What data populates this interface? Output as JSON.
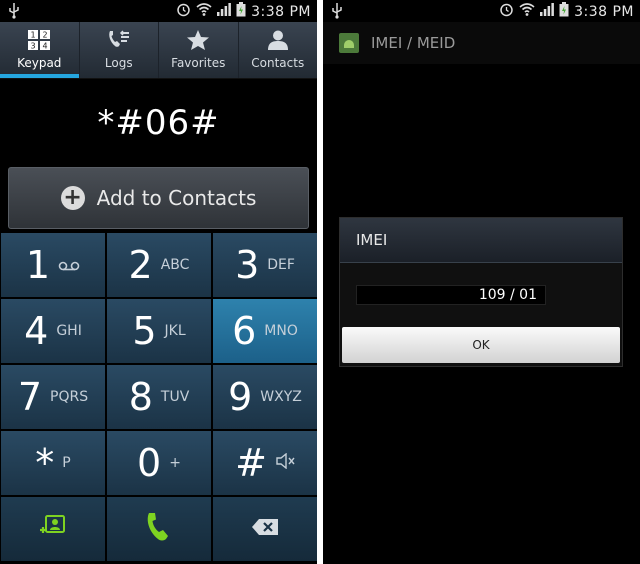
{
  "status": {
    "time": "3:38 PM"
  },
  "dialer": {
    "tabs": [
      {
        "label": "Keypad",
        "icon": "keypad-icon"
      },
      {
        "label": "Logs",
        "icon": "logs-icon"
      },
      {
        "label": "Favorites",
        "icon": "star-icon"
      },
      {
        "label": "Contacts",
        "icon": "contacts-icon"
      }
    ],
    "active_tab": "Keypad",
    "dialed_number": "*#06#",
    "add_to_contacts_label": "Add to Contacts",
    "keys": [
      {
        "digit": "1",
        "letters": ""
      },
      {
        "digit": "2",
        "letters": "ABC"
      },
      {
        "digit": "3",
        "letters": "DEF"
      },
      {
        "digit": "4",
        "letters": "GHI"
      },
      {
        "digit": "5",
        "letters": "JKL"
      },
      {
        "digit": "6",
        "letters": "MNO"
      },
      {
        "digit": "7",
        "letters": "PQRS"
      },
      {
        "digit": "8",
        "letters": "TUV"
      },
      {
        "digit": "9",
        "letters": "WXYZ"
      },
      {
        "digit": "*",
        "letters": "P"
      },
      {
        "digit": "0",
        "letters": "+"
      },
      {
        "digit": "#",
        "letters": ""
      }
    ],
    "accent_color": "#25a6df",
    "call_color": "#7ed321"
  },
  "imei_screen": {
    "title": "IMEI / MEID",
    "dialog_title": "IMEI",
    "imei_value": "109 / 01",
    "ok_label": "OK"
  }
}
